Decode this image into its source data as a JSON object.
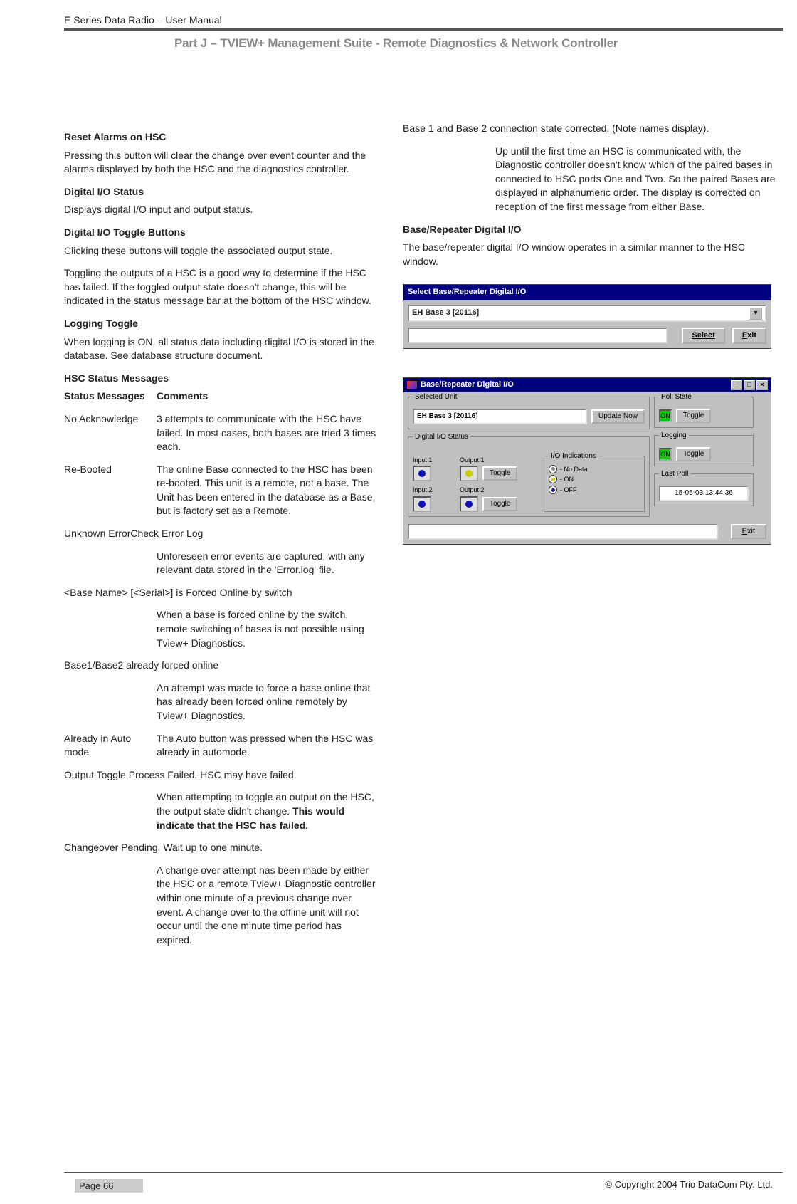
{
  "header": "E Series Data Radio – User Manual",
  "part_title": "Part J – TVIEW+ Management Suite -  Remote Diagnostics & Network Controller",
  "left": {
    "h1": "Reset Alarms on HSC",
    "p1": "Pressing this button will clear the change over event counter and the alarms displayed by both the HSC and the diagnostics controller.",
    "h2": "Digital I/O Status",
    "p2": "Displays digital I/O input and output status.",
    "h3": "Digital I/O Toggle Buttons",
    "p3": "Clicking these buttons will toggle the associated output state.",
    "p4": "Toggling the outputs of a HSC is a good way to determine if the HSC has failed.  If the toggled output state doesn't change, this will be indicated in the status message bar at the bottom of the HSC window.",
    "h4": "Logging Toggle",
    "p5": "When logging is ON, all status data including digital I/O is stored in the database. See  database structure document.",
    "h5": "HSC Status Messages",
    "thA": "Status Messages",
    "thB": "Comments",
    "rows": [
      {
        "a": "No Acknowledge",
        "b": "3 attempts to communicate with the HSC have failed.  In most cases, both bases are tried 3 times each."
      },
      {
        "a": "Re-Booted",
        "b": "The online Base connected to the HSC has been re-booted. This unit is a remote, not a base.          The Unit has been entered in the database as a Base, but is factory set as a Remote."
      }
    ],
    "line_unknown": "Unknown ErrorCheck Error Log",
    "unknown_b": "Unforeseen error events are captured, with any relevant data stored in the 'Error.log' file.",
    "line_forced": "<Base Name> [<Serial>] is Forced Online by switch",
    "forced_b": "When a base is forced online by the switch, remote switching of bases is not possible using Tview+ Diagnostics.",
    "line_already_forced": "Base1/Base2 already forced online",
    "already_forced_b": "An attempt was made to force a base online that has already been forced online remotely by Tview+ Diagnostics.",
    "row_auto_a": "Already in Auto mode",
    "row_auto_b": "The Auto button was pressed when the HSC was already in automode.",
    "line_toggle_fail": "Output Toggle Process Failed. HSC may have failed.",
    "toggle_fail_b1": "When attempting to toggle an output on the HSC, the output state didn't change.  ",
    "toggle_fail_b2": "This would indicate that the HSC has failed.",
    "line_changeover": "Changeover Pending. Wait up to one minute.",
    "changeover_b": "A change over attempt has been made by either the HSC or a remote Tview+ Diagnostic controller within one minute of a previous change over event.  A change over to the offline unit will not occur until the one minute time period has expired."
  },
  "right": {
    "p1a": "Base 1 and Base 2 connection state corrected. (Note names display).",
    "p1b": "Up until the first time an HSC is communicated with, the Diagnostic controller doesn't know which of the paired bases in connected to HSC ports One and Two. So the paired Bases are displayed in alphanumeric order.  The display is corrected on reception of the first message from either Base.",
    "h1": "Base/Repeater Digital I/O",
    "p2": "The base/repeater digital I/O window operates in a similar manner to the HSC window."
  },
  "win1": {
    "title": "Select Base/Repeater Digital I/O",
    "selected": "EH Base 3 [20116]",
    "select_btn": "Select",
    "exit_btn": "Exit"
  },
  "win2": {
    "title": "Base/Repeater Digital I/O",
    "selected_unit_frame": "Selected Unit",
    "selected": "EH Base 3 [20116]",
    "update_btn": "Update Now",
    "poll_frame": "Poll State",
    "on": "ON",
    "toggle": "Toggle",
    "logging_frame": "Logging",
    "digital_frame": "Digital I/O Status",
    "in1": "Input 1",
    "in2": "Input 2",
    "out1": "Output 1",
    "out2": "Output 2",
    "ind_frame": "I/O Indications",
    "nodata": "- No Data",
    "on_ind": "- ON",
    "off_ind": "- OFF",
    "lastpoll_frame": "Last Poll",
    "lastpoll": "15-05-03  13:44:36",
    "exit_btn": "Exit"
  },
  "footer": {
    "page": "Page 66",
    "copyright": "© Copyright 2004 Trio DataCom Pty. Ltd."
  }
}
